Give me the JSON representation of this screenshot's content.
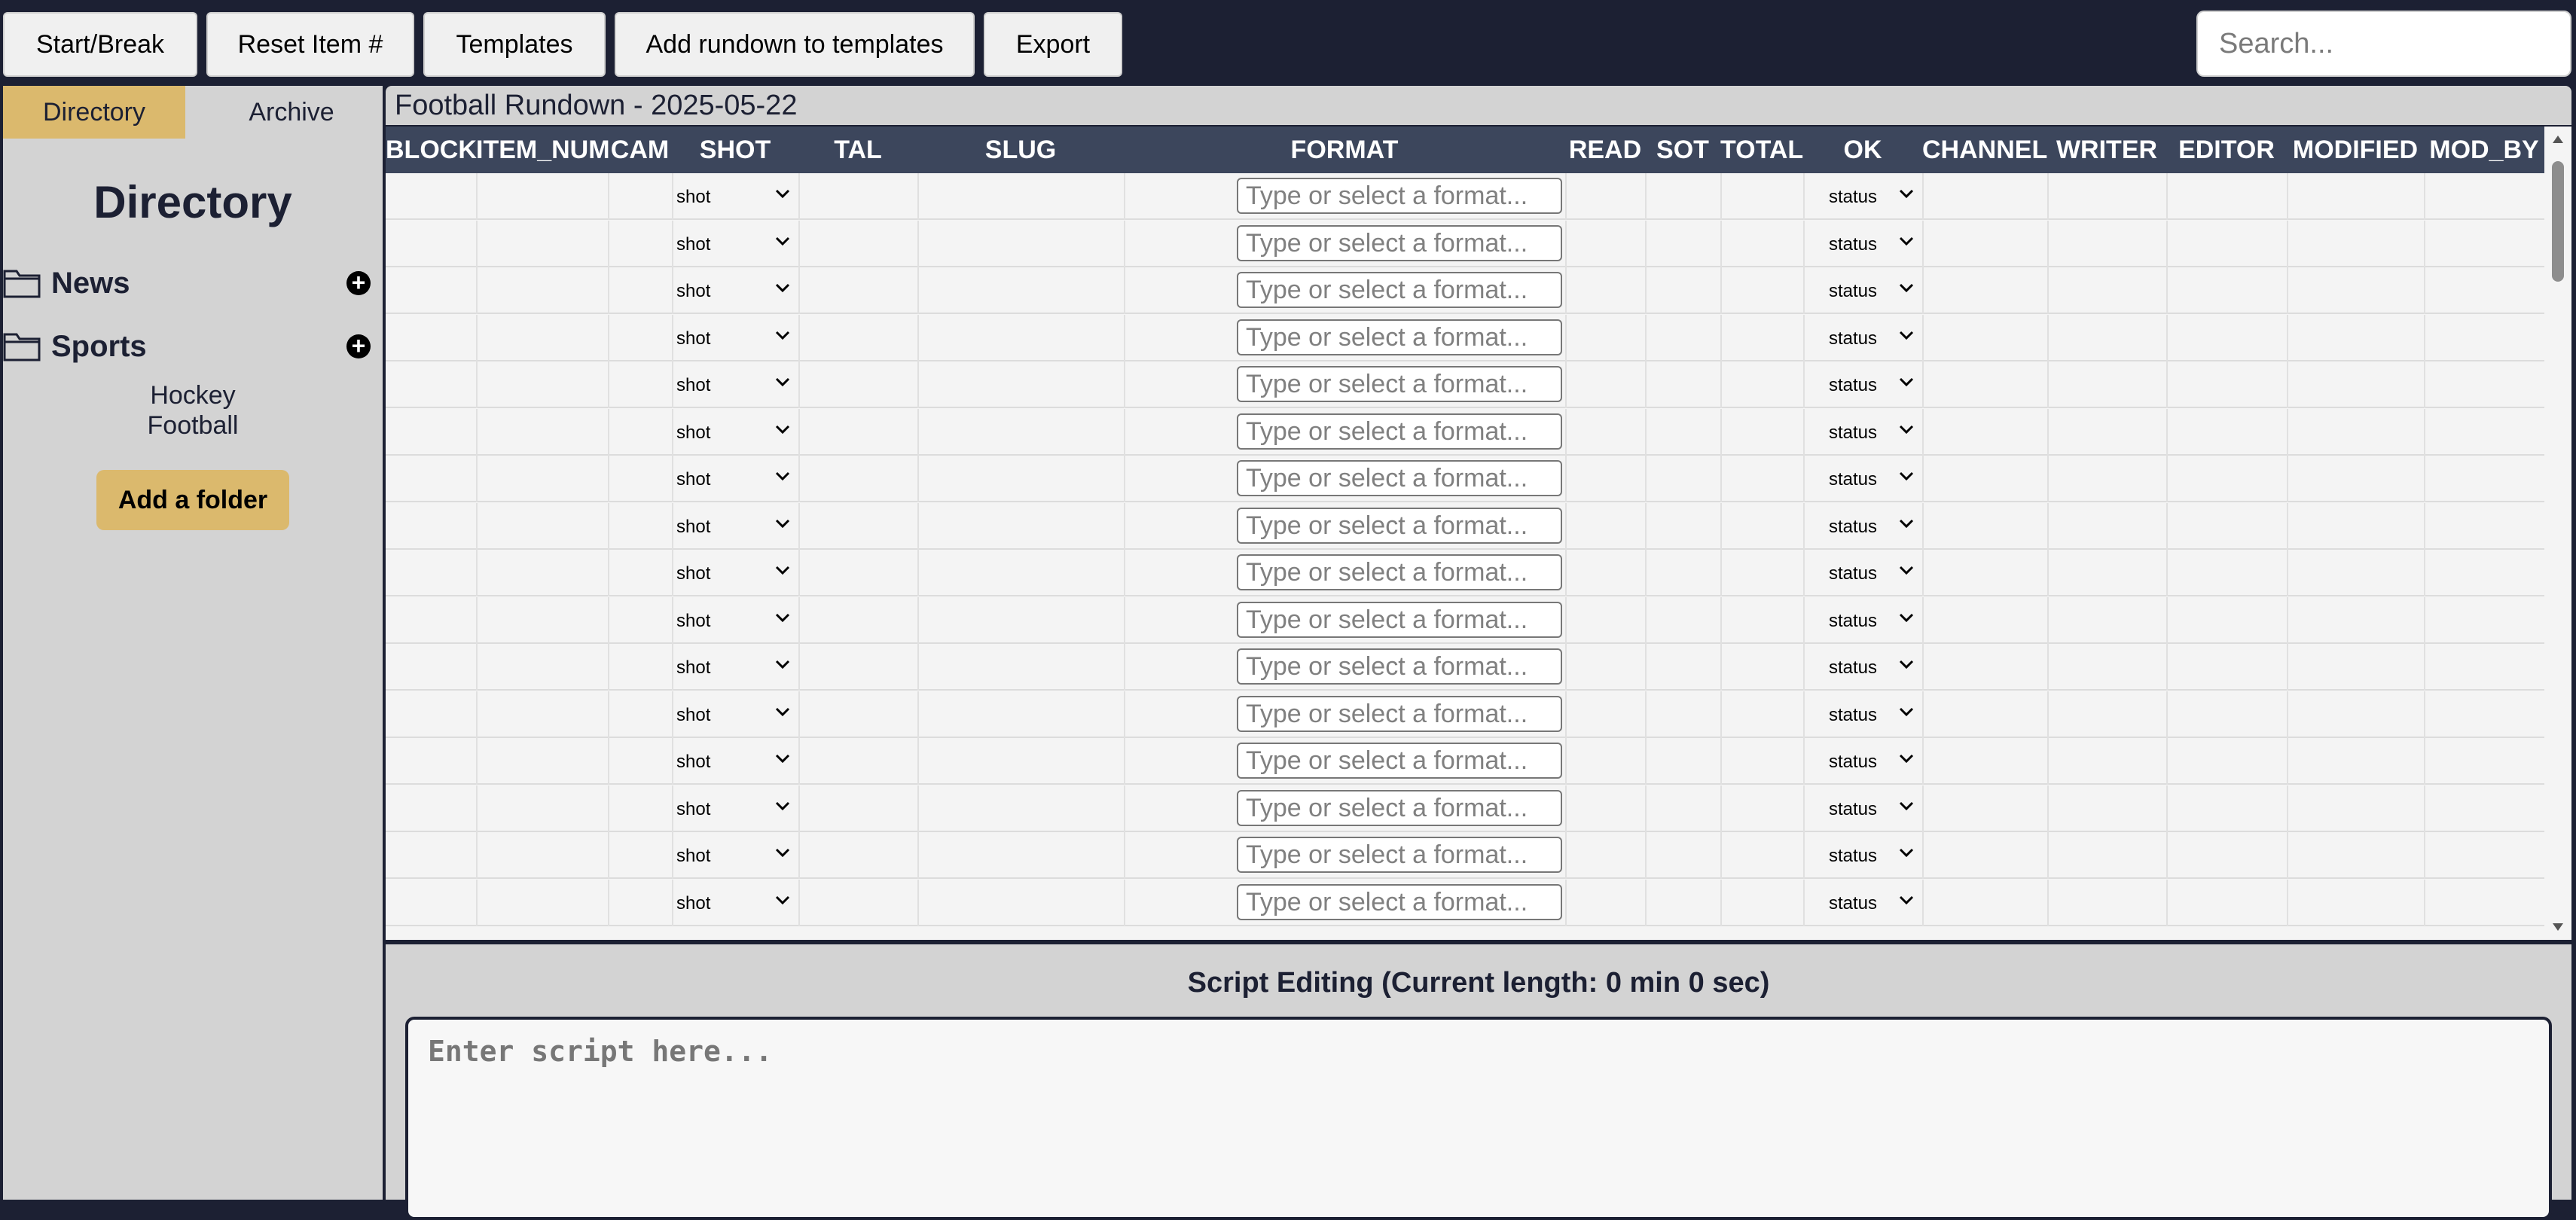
{
  "toolbar": {
    "buttons": [
      "Start/Break",
      "Reset Item #",
      "Templates",
      "Add rundown to templates",
      "Export"
    ],
    "search_placeholder": "Search..."
  },
  "sidebar": {
    "tabs": [
      "Directory",
      "Archive"
    ],
    "active_tab": "Directory",
    "title": "Directory",
    "folders": [
      {
        "name": "News",
        "icon": "folder-icon",
        "add_icon": "plus-circle-icon",
        "children": []
      },
      {
        "name": "Sports",
        "icon": "folder-icon",
        "add_icon": "plus-circle-icon",
        "children": [
          "Hockey",
          "Football"
        ]
      }
    ],
    "add_folder_label": "Add a folder"
  },
  "rundown": {
    "title": "Football Rundown - 2025-05-22",
    "columns": [
      "BLOCK",
      "ITEM_NUM",
      "CAM",
      "SHOT",
      "TAL",
      "SLUG",
      "FORMAT",
      "READ",
      "SOT",
      "TOTAL",
      "OK",
      "CHANNEL",
      "WRITER",
      "EDITOR",
      "MODIFIED",
      "MOD_BY"
    ],
    "row_count": 16,
    "shot_value": "shot",
    "format_placeholder": "Type or select a format...",
    "status_value": "status"
  },
  "script": {
    "title": "Script Editing (Current length: 0 min 0 sec)",
    "placeholder": "Enter script here..."
  },
  "colors": {
    "navy": "#1c2033",
    "header": "#3c465c",
    "accent": "#dbb96d",
    "panel": "#d3d3d3"
  }
}
